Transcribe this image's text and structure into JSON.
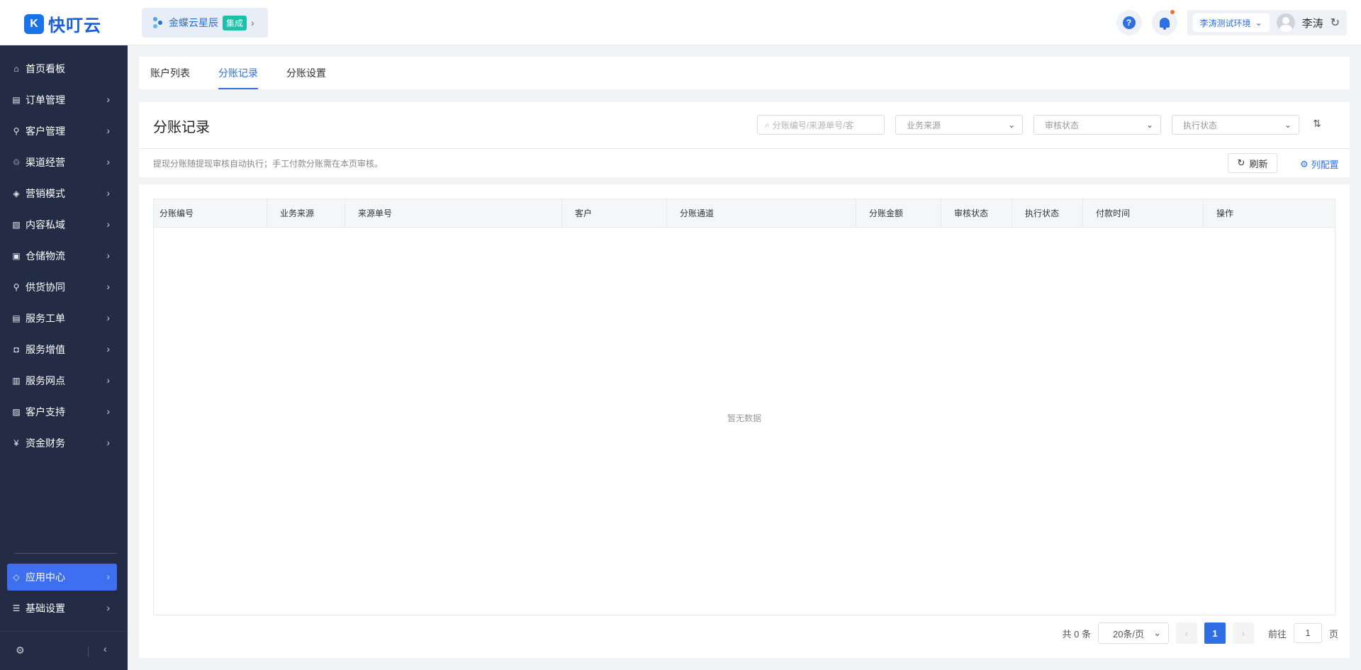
{
  "header": {
    "logo_mark": "K",
    "logo_text": "快叮云",
    "integration": {
      "name": "金蝶云星辰",
      "badge": "集成"
    },
    "environment": "李涛测试环境",
    "user_name": "李涛"
  },
  "sidebar": {
    "items": [
      {
        "label": "首页看板",
        "icon": "home-icon"
      },
      {
        "label": "订单管理",
        "icon": "clipboard-icon"
      },
      {
        "label": "客户管理",
        "icon": "user-icon"
      },
      {
        "label": "渠道经营",
        "icon": "channel-icon"
      },
      {
        "label": "营销模式",
        "icon": "tag-icon"
      },
      {
        "label": "内容私域",
        "icon": "image-icon"
      },
      {
        "label": "仓储物流",
        "icon": "box-icon"
      },
      {
        "label": "供货协同",
        "icon": "supply-icon"
      },
      {
        "label": "服务工单",
        "icon": "ticket-icon"
      },
      {
        "label": "服务增值",
        "icon": "bag-icon"
      },
      {
        "label": "服务网点",
        "icon": "store-icon"
      },
      {
        "label": "客户支持",
        "icon": "support-icon"
      },
      {
        "label": "资金财务",
        "icon": "yen-icon"
      }
    ],
    "bottom_items": [
      {
        "label": "应用中心",
        "icon": "cube-icon"
      },
      {
        "label": "基础设置",
        "icon": "sliders-icon"
      }
    ]
  },
  "tabs": [
    {
      "label": "账户列表"
    },
    {
      "label": "分账记录"
    },
    {
      "label": "分账设置"
    }
  ],
  "filters": {
    "title": "分账记录",
    "search_placeholder": "分账编号/来源单号/客",
    "select_source": "业务来源",
    "select_audit": "审核状态",
    "select_exec": "执行状态",
    "tip": "提现分账随提现审核自动执行；手工付款分账需在本页审核。",
    "refresh_label": "刷新",
    "columns_label": "列配置"
  },
  "table": {
    "columns": [
      "分账编号",
      "业务来源",
      "来源单号",
      "客户",
      "分账通道",
      "分账金额",
      "审核状态",
      "执行状态",
      "付款时间",
      "操作"
    ],
    "empty_text": "暂无数据"
  },
  "pagination": {
    "total_text": "共 0 条",
    "page_size": "20条/页",
    "current_page": "1",
    "goto_label": "前往",
    "goto_value": "1",
    "page_unit": "页"
  },
  "colors": {
    "accent": "#2f6fe4",
    "sidebar_bg": "#232c44",
    "active_nav": "#3d6ff0",
    "badge": "#1dbfa8"
  }
}
